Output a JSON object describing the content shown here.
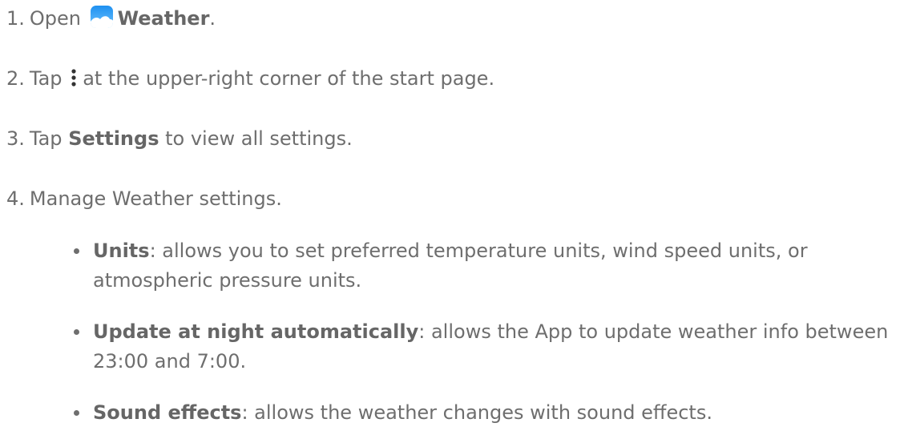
{
  "steps": [
    {
      "num": "1.",
      "pre": "Open",
      "bold": "Weather",
      "post": "."
    },
    {
      "num": "2.",
      "pre": "Tap",
      "post": "at the upper-right corner of the start page."
    },
    {
      "num": "3.",
      "pre": "Tap",
      "bold": "Settings",
      "post": "to view all settings."
    },
    {
      "num": "4.",
      "text": "Manage Weather settings."
    }
  ],
  "bullets": [
    {
      "bold": "Units",
      "text": ": allows you to set preferred temperature units, wind speed units, or atmospheric pressure units."
    },
    {
      "bold": "Update at night automatically",
      "text": ": allows the App to update weather info between 23:00 and 7:00."
    },
    {
      "bold": "Sound effects",
      "text": ": allows the weather changes with sound effects."
    }
  ],
  "icons": {
    "weather_app": "weather-app-icon",
    "more_options": "more-options-icon"
  },
  "colors": {
    "text": "#6e6e6e",
    "icon_sky_top": "#1e90f0",
    "icon_sky_bottom": "#6ec3ff"
  }
}
